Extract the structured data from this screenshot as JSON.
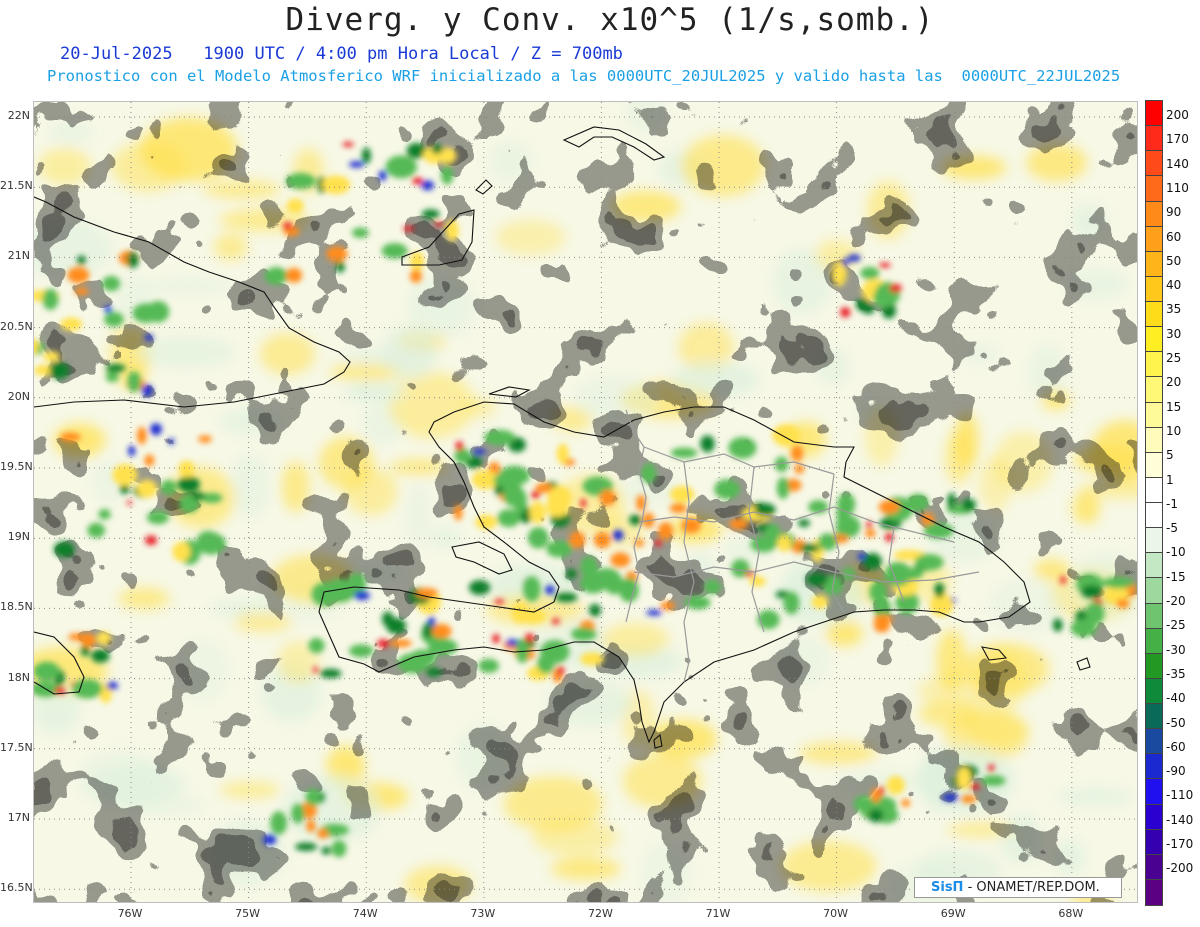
{
  "header": {
    "title": "Diverg. y Conv. x10^5 (1/s,somb.)",
    "subtitle_line1": "20-Jul-2025   1900 UTC / 4:00 pm Hora Local / Z = 700mb",
    "subtitle_line2": "Pronostico con el Modelo Atmosferico WRF inicializado a las 0000UTC_20JUL2025 y valido hasta las  0000UTC_22JUL2025"
  },
  "map": {
    "lat_labels": [
      "22N",
      "21.5N",
      "21N",
      "20.5N",
      "20N",
      "19.5N",
      "19N",
      "18.5N",
      "18N",
      "17.5N",
      "17N",
      "16.5N"
    ],
    "lon_labels": [
      "76W",
      "75W",
      "74W",
      "73W",
      "72W",
      "71W",
      "70W",
      "69W",
      "68W"
    ],
    "field_colors": {
      "weak_convergence": "#ddf0dd",
      "convergence": "#55b955",
      "strong_convergence": "#0a7f2a",
      "very_strong_convergence": "#1f2fd0",
      "weak_divergence": "#fdfac4",
      "divergence": "#ffe14d",
      "strong_divergence": "#ff8c1a",
      "very_strong_divergence": "#e8232a",
      "coastline": "#111111",
      "province_border": "#999999"
    }
  },
  "colorbar": {
    "labels": [
      "200",
      "170",
      "140",
      "110",
      "90",
      "60",
      "50",
      "40",
      "35",
      "30",
      "25",
      "20",
      "15",
      "10",
      "5",
      "1",
      "-1",
      "-5",
      "-10",
      "-15",
      "-20",
      "-25",
      "-30",
      "-35",
      "-40",
      "-50",
      "-60",
      "-90",
      "-110",
      "-140",
      "-170",
      "-200"
    ],
    "colors": [
      "#ff0000",
      "#ff2a1a",
      "#ff4a1a",
      "#ff6a1a",
      "#ff8a1a",
      "#ffa01a",
      "#ffb41a",
      "#ffc81a",
      "#ffdc1a",
      "#ffee22",
      "#fff44d",
      "#fff877",
      "#fffa99",
      "#fffcbb",
      "#fffed9",
      "#ffffff",
      "#ffffff",
      "#eaf6ea",
      "#c4e8c4",
      "#9ed89e",
      "#6fc46f",
      "#45b045",
      "#229922",
      "#0f8a3a",
      "#0a6a5a",
      "#1a4aa0",
      "#1a2ad0",
      "#2010f0",
      "#2a00d0",
      "#3500b0",
      "#4a0090",
      "#5a0080"
    ]
  },
  "credit": {
    "brand": "SisΠ",
    "text": "- ONAMET/REP.DOM."
  }
}
